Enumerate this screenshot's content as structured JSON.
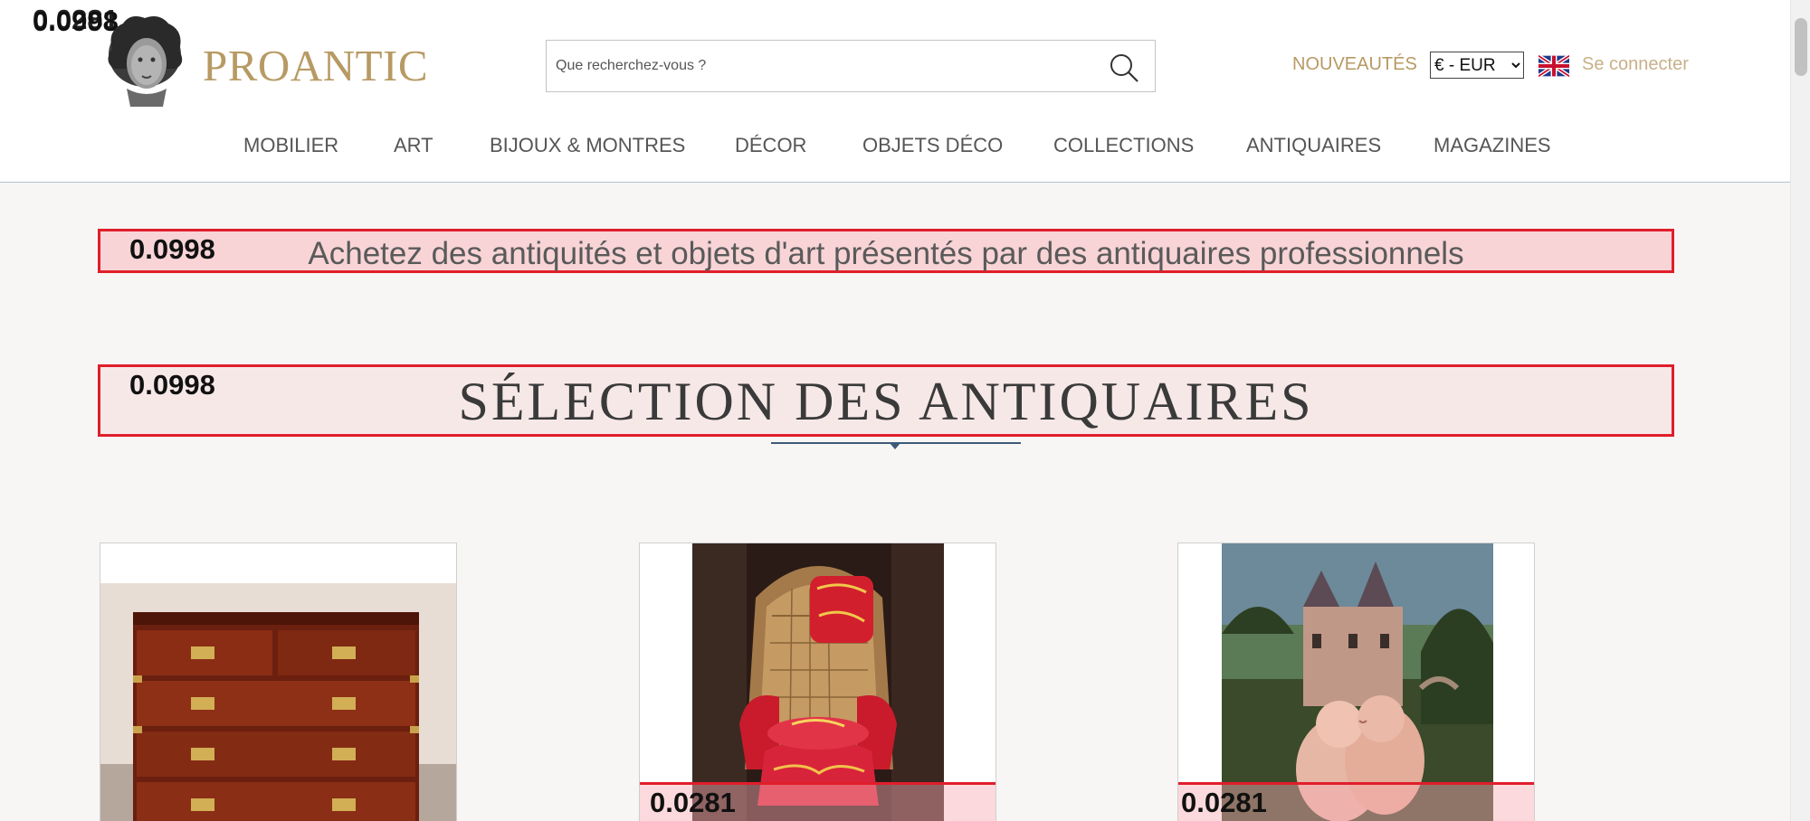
{
  "overlay_scores": {
    "top_left": "0.0998",
    "top_left_behind": "0.0281",
    "tagline": "0.0998",
    "title": "0.0998",
    "card2": "0.0281",
    "card3": "0.0281"
  },
  "header": {
    "brand": "PROANTIC",
    "search_placeholder": "Que recherchez-vous ?",
    "nouveautes": "NOUVEAUTÉS",
    "currency": "€ - EUR",
    "login": "Se connecter"
  },
  "nav": {
    "items": [
      "MOBILIER",
      "ART",
      "BIJOUX & MONTRES",
      "DÉCOR",
      "OBJETS DÉCO",
      "COLLECTIONS",
      "ANTIQUAIRES",
      "MAGAZINES"
    ]
  },
  "tagline": "Achetez des antiquités et objets d'art présentés par des antiquaires professionnels",
  "section_title": "SÉLECTION DES ANTIQUAIRES",
  "colors": {
    "gold": "#b79a63",
    "overlay_red": "#e01e2b",
    "rule_blue": "#3d5a78"
  },
  "icons": {
    "search": "magnifier-icon",
    "flag": "uk-flag-icon",
    "logo": "bust-logo"
  }
}
